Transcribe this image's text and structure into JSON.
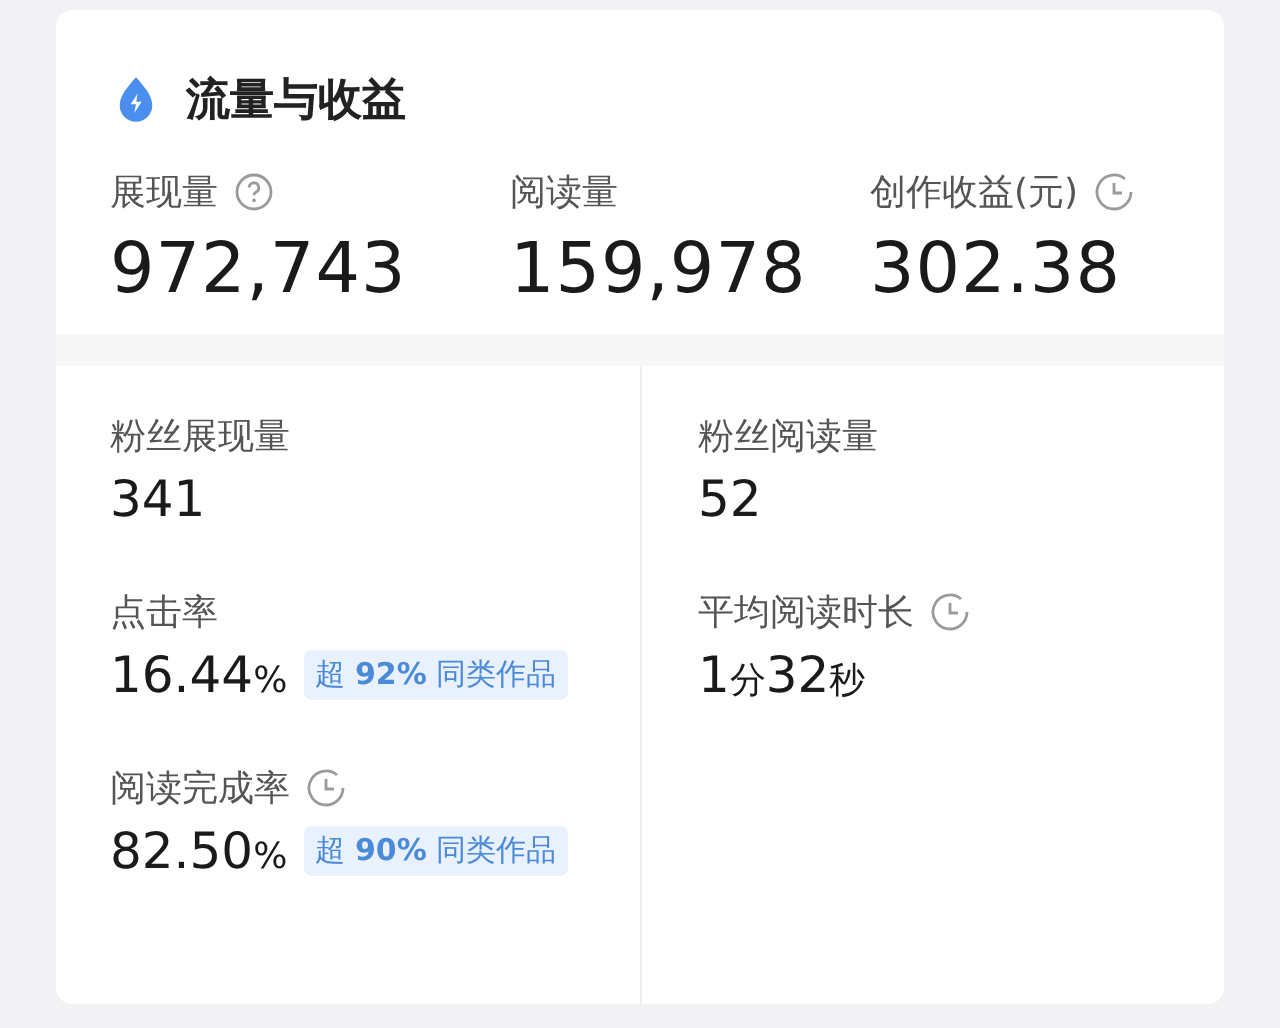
{
  "title": "流量与收益",
  "summary": [
    {
      "label": "展现量",
      "kind": "help",
      "value": "972,743"
    },
    {
      "label": "阅读量",
      "value": "159,978"
    },
    {
      "label": "创作收益(元)",
      "kind": "timed",
      "value": "302.38"
    }
  ],
  "details": [
    [
      {
        "label": "粉丝展现量",
        "value_parts": [
          {
            "kind": "number",
            "text": "341"
          }
        ]
      },
      {
        "label": "点击率",
        "value_parts": [
          {
            "kind": "number",
            "text": "16.44"
          },
          {
            "kind": "unit",
            "text": "%"
          }
        ],
        "badge": "超 **92%** 同类作品"
      },
      {
        "label": "阅读完成率",
        "kind": "timed",
        "value_parts": [
          {
            "kind": "number",
            "text": "82.50"
          },
          {
            "kind": "unit",
            "text": "%"
          }
        ],
        "badge": "超 **90%** 同类作品"
      }
    ],
    [
      {
        "label": "粉丝阅读量",
        "value_parts": [
          {
            "kind": "number",
            "text": "52"
          }
        ]
      },
      {
        "label": "平均阅读时长",
        "kind": "timed",
        "value_parts": [
          {
            "kind": "number",
            "text": "1"
          },
          {
            "kind": "unit",
            "text": "分"
          },
          {
            "kind": "number",
            "text": "32"
          },
          {
            "kind": "unit",
            "text": "秒"
          }
        ]
      }
    ]
  ]
}
